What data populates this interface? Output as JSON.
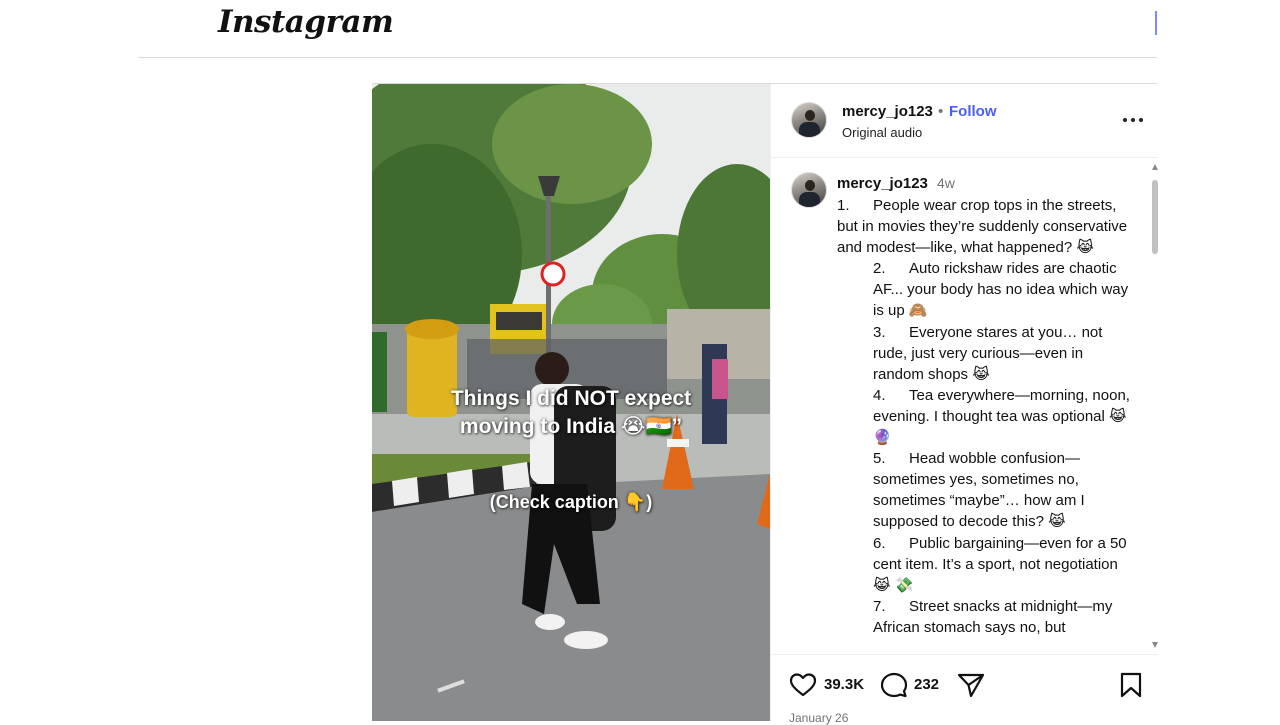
{
  "app": {
    "logo_text": "Instagram"
  },
  "post": {
    "username": "mercy_jo123",
    "separator": "•",
    "follow_label": "Follow",
    "audio_label": "Original audio",
    "media": {
      "overlay_title_line1": "Things I did NOT expect",
      "overlay_title_line2": "moving to India 😭🇮🇳”",
      "overlay_subtitle": "(Check caption 👇)"
    },
    "caption": {
      "username": "mercy_jo123",
      "time_ago": "4w",
      "items": [
        {
          "num": "1.",
          "text": "People wear crop tops in the streets, but in movies they’re suddenly conservative and modest—like, what happened? 😹"
        },
        {
          "num": "2.",
          "text": "Auto rickshaw rides are chaotic AF... your body has no idea which way is up 🙈"
        },
        {
          "num": "3.",
          "text": "Everyone stares at you… not rude, just very curious—even in random shops 😹"
        },
        {
          "num": "4.",
          "text": "Tea everywhere—morning, noon, evening. I thought tea was optional 😹 🔮"
        },
        {
          "num": "5.",
          "text": "Head wobble confusion—sometimes yes, sometimes no, sometimes “maybe”… how am I supposed to decode this? 😹"
        },
        {
          "num": "6.",
          "text": "Public bargaining—even for a 50 cent item. It’s a sport, not negotiation 😹 💸"
        },
        {
          "num": "7.",
          "text": "Street snacks at midnight—my African stomach says no, but"
        }
      ]
    },
    "likes": "39.3K",
    "comments": "232",
    "date": "January 26"
  }
}
